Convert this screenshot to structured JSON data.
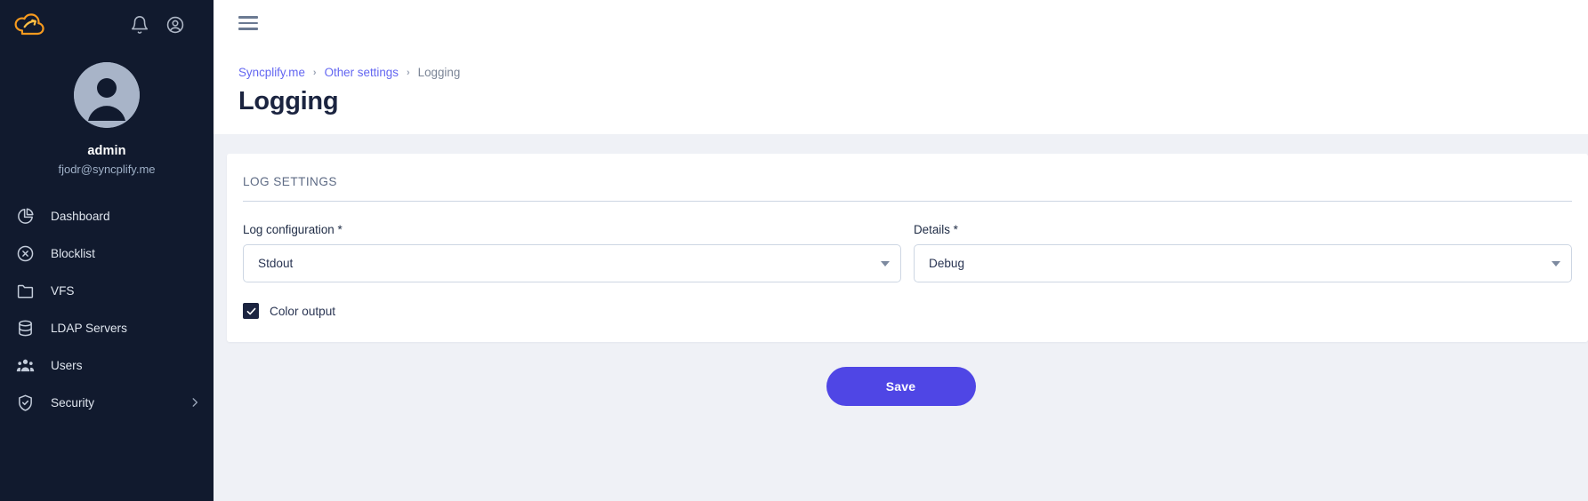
{
  "sidebar": {
    "logo_icon": "cloud-swoosh-logo",
    "logo_color": "#f79a1e",
    "background_color": "#111a2e",
    "top_icons": [
      {
        "name": "notifications-bell-icon",
        "icon": "bell"
      },
      {
        "name": "account-circle-icon",
        "icon": "account-circle"
      }
    ],
    "profile": {
      "avatar_icon": "user-avatar",
      "username": "admin",
      "email": "fjodr@syncplify.me"
    },
    "items": [
      {
        "label": "Dashboard",
        "icon": "pie-chart-icon",
        "name": "sidebar-item-dashboard",
        "has_submenu": false
      },
      {
        "label": "Blocklist",
        "icon": "circle-x-icon",
        "name": "sidebar-item-blocklist",
        "has_submenu": false
      },
      {
        "label": "VFS",
        "icon": "folder-icon",
        "name": "sidebar-item-vfs",
        "has_submenu": false
      },
      {
        "label": "LDAP Servers",
        "icon": "database-icon",
        "name": "sidebar-item-ldap-servers",
        "has_submenu": false
      },
      {
        "label": "Users",
        "icon": "users-icon",
        "name": "sidebar-item-users",
        "has_submenu": false
      },
      {
        "label": "Security",
        "icon": "shield-check-icon",
        "name": "sidebar-item-security",
        "has_submenu": true
      }
    ]
  },
  "topbar": {
    "menu_icon": "hamburger-menu-icon"
  },
  "header": {
    "breadcrumb": [
      {
        "label": "Syncplify.me",
        "is_link": true
      },
      {
        "label": "Other settings",
        "is_link": true
      },
      {
        "label": "Logging",
        "is_link": false
      }
    ],
    "separator": "›",
    "title": "Logging",
    "link_color": "#6366f1"
  },
  "main": {
    "card": {
      "section_title": "LOG SETTINGS",
      "fields": [
        {
          "label": "Log configuration *",
          "value": "Stdout",
          "type": "select",
          "name": "log-configuration-select"
        },
        {
          "label": "Details *",
          "value": "Debug",
          "type": "select",
          "name": "details-select"
        }
      ],
      "checkbox": {
        "label": "Color output",
        "checked": true,
        "name": "color-output-checkbox"
      }
    },
    "save_label": "Save",
    "accent_color": "#4f46e5",
    "page_background": "#eff1f6"
  }
}
